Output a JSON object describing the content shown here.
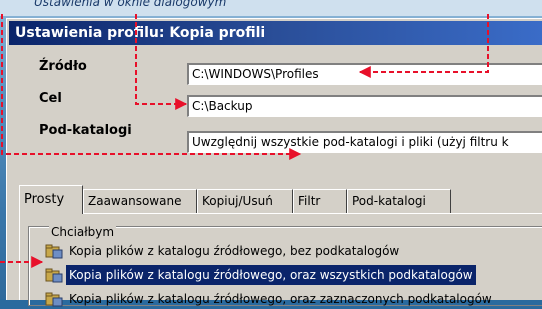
{
  "header_fragment": "Ustawienia w oknie dialogowym",
  "window": {
    "title": "Ustawienia profilu: Kopia profili"
  },
  "fields": [
    {
      "label": "Źródło",
      "value": "C:\\WINDOWS\\Profiles"
    },
    {
      "label": "Cel",
      "value": "C:\\Backup"
    },
    {
      "label": "Pod-katalogi",
      "value": "Uwzględnij wszystkie pod-katalogi i pliki (użyj filtru k"
    }
  ],
  "tabs": [
    {
      "label": "Prosty",
      "active": true
    },
    {
      "label": "Zaawansowane",
      "active": false
    },
    {
      "label": "Kopiuj/Usuń",
      "active": false
    },
    {
      "label": "Filtr",
      "active": false
    },
    {
      "label": "Pod-katalogi",
      "active": false
    }
  ],
  "group": {
    "legend": "Chciałbym",
    "options": [
      {
        "label": "Kopia plików z katalogu źródłowego, bez podkatalogów",
        "icon": "copy-folder-icon",
        "selected": false
      },
      {
        "label": "Kopia plików z katalogu źródłowego, oraz wszystkich podkatalogów",
        "icon": "copy-folder-icon",
        "selected": true
      },
      {
        "label": "Kopia plików z katalogu źródłowego, oraz zaznaczonych podkatalogów",
        "icon": "copy-folder-icon",
        "selected": false
      }
    ]
  },
  "colors": {
    "title_bar": "#0a246a",
    "selection": "#0a246a",
    "annotation_arrow": "#e8102a"
  }
}
